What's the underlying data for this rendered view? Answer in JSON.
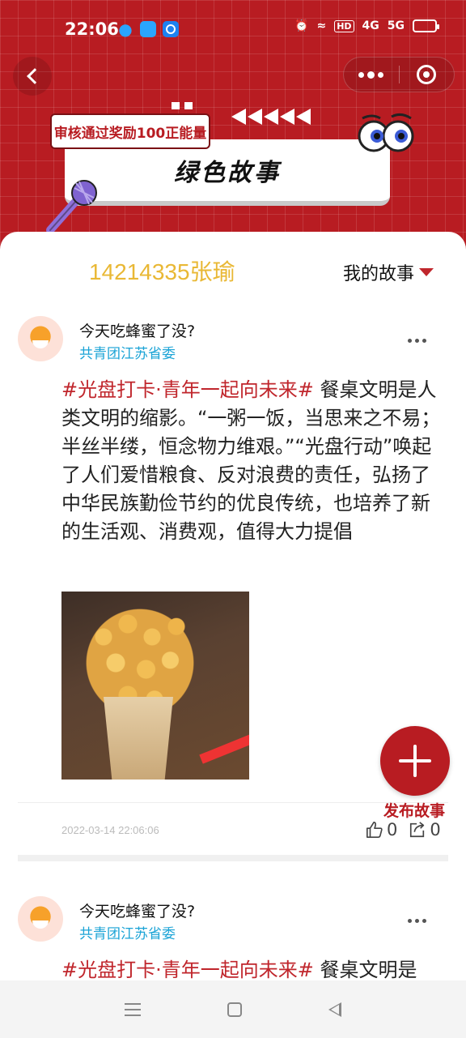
{
  "status_bar": {
    "time": "22:06",
    "hd_label": "HD",
    "signal_1": "4G",
    "signal_2": "5G"
  },
  "banner": {
    "tag": "审核通过奖励100正能量",
    "title": "绿色故事"
  },
  "user": {
    "id_name": "14214335张瑜"
  },
  "my_stories": {
    "label": "我的故事"
  },
  "posts": [
    {
      "title": "今天吃蜂蜜了没?",
      "org": "共青团江苏省委",
      "hashtag": "#光盘打卡·青年一起向未来#",
      "body": " 餐桌文明是人类文明的缩影。“一粥一饭，当思来之不易；半丝半缕，恒念物力维艰。”“光盘行动”唤起了人们爱惜粮食、反对浪费的责任，弘扬了中华民族勤俭节约的优良传统，也培养了新的生活观、消费观，值得大力提倡",
      "date": "2022-03-14 22:06:06",
      "likes": "0",
      "shares": "0"
    },
    {
      "title": "今天吃蜂蜜了没?",
      "org": "共青团江苏省委",
      "hashtag": "#光盘打卡·青年一起向未来#",
      "body": " 餐桌文明是"
    }
  ],
  "fab": {
    "label": "发布故事"
  },
  "colors": {
    "brand_red": "#b81c22",
    "hashtag_red": "#c0262c",
    "user_gold": "#e9b835",
    "org_blue": "#1aa3d6"
  },
  "icons": [
    "back-icon",
    "more-dots-icon",
    "target-icon",
    "microphone-icon",
    "eyes-icon",
    "like-icon",
    "share-icon",
    "plus-icon"
  ]
}
